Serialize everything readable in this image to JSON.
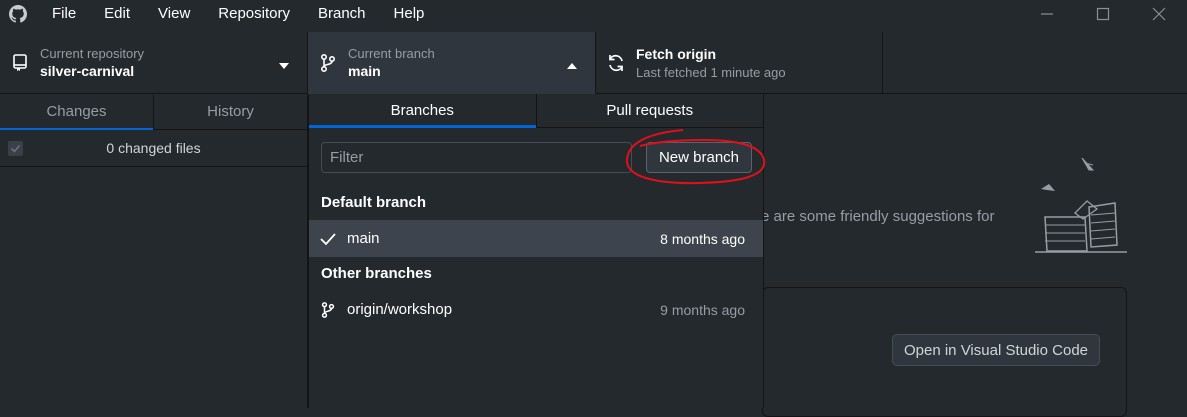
{
  "menu": [
    "File",
    "Edit",
    "View",
    "Repository",
    "Branch",
    "Help"
  ],
  "toolbar": {
    "repo_label": "Current repository",
    "repo_value": "silver-carnival",
    "branch_label": "Current branch",
    "branch_value": "main",
    "fetch_title": "Fetch origin",
    "fetch_sub": "Last fetched 1 minute ago"
  },
  "sidebar": {
    "tabs": [
      "Changes",
      "History"
    ],
    "changed_files": "0 changed files"
  },
  "main": {
    "suggest_text": "e are some friendly suggestions for",
    "open_vs_label": "Open in Visual Studio Code"
  },
  "dropdown": {
    "tabs": [
      "Branches",
      "Pull requests"
    ],
    "filter_placeholder": "Filter",
    "new_branch_label": "New branch",
    "default_header": "Default branch",
    "default_branches": [
      {
        "name": "main",
        "time": "8 months ago"
      }
    ],
    "other_header": "Other branches",
    "other_branches": [
      {
        "name": "origin/workshop",
        "time": "9 months ago"
      }
    ]
  },
  "colors": {
    "background": "#24292e",
    "accent": "#0366d6",
    "annotation": "#e0101a"
  }
}
